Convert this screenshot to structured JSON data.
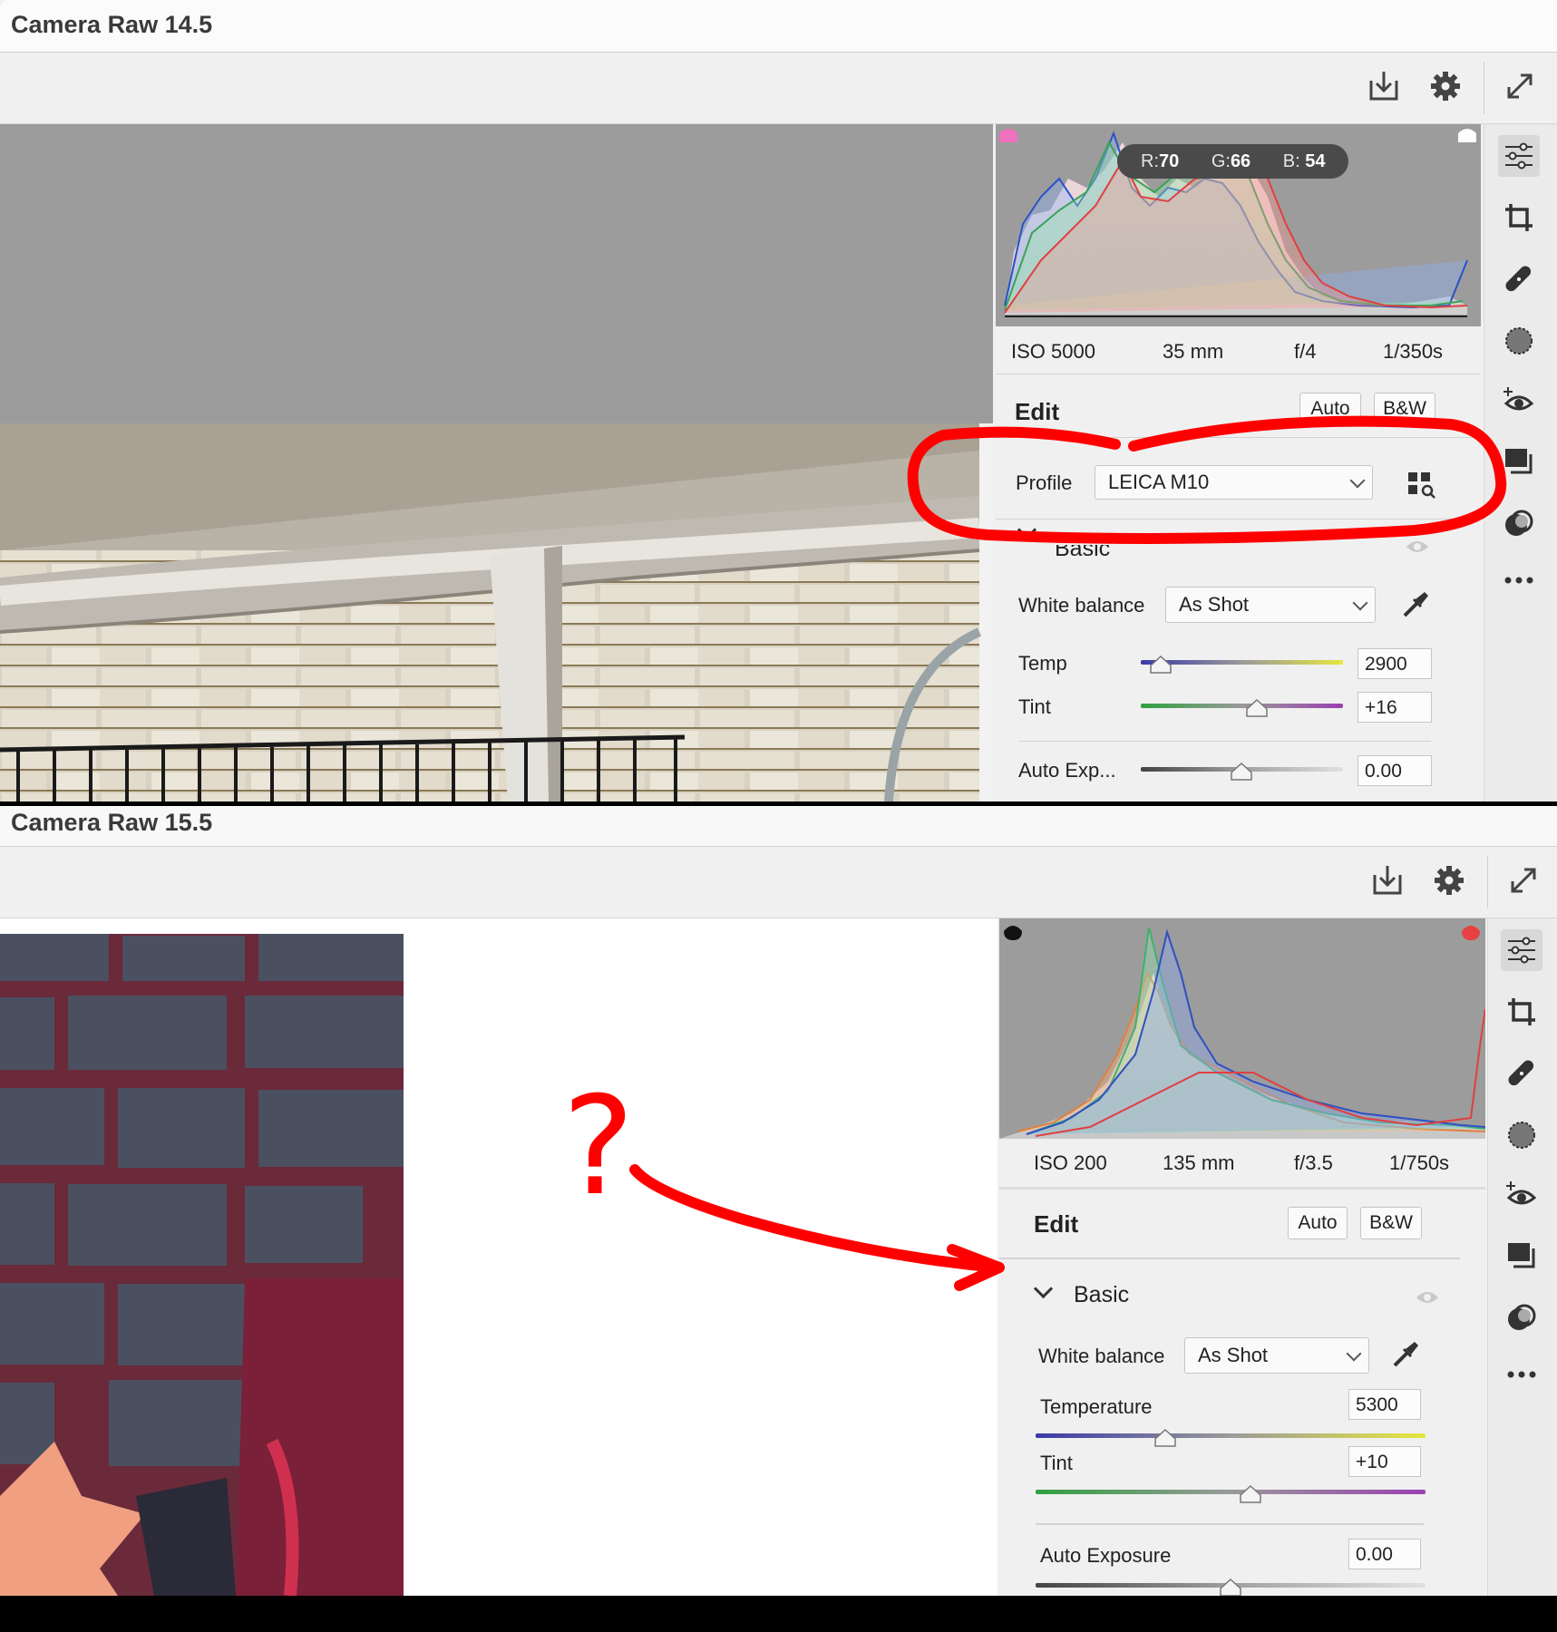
{
  "top": {
    "title": "Camera Raw 14.5",
    "toolbar": {
      "save_icon": "download-icon",
      "settings_icon": "gear-icon",
      "fullscreen_icon": "expand-icon"
    },
    "histogram": {
      "r_label": "R:",
      "r_value": "70",
      "g_label": "G:",
      "g_value": "66",
      "b_label": "B: ",
      "b_value": "54"
    },
    "meta": {
      "iso": "ISO 5000",
      "focal": "35 mm",
      "aperture": "f/4",
      "shutter": "1/350s"
    },
    "edit": {
      "title": "Edit",
      "auto": "Auto",
      "bw": "B&W"
    },
    "profile": {
      "label": "Profile",
      "value": "LEICA M10"
    },
    "basic": {
      "label": "Basic"
    },
    "white_balance": {
      "label": "White balance",
      "value": "As Shot"
    },
    "sliders": [
      {
        "label": "Temp",
        "value": "2900",
        "position": 0.08
      },
      {
        "label": "Tint",
        "value": "+16",
        "position": 0.58
      },
      {
        "label": "Auto Exp...",
        "value": "0.00",
        "position": 0.5
      }
    ]
  },
  "bottom": {
    "title": "Camera Raw 15.5",
    "histogram": {},
    "meta": {
      "iso": "ISO 200",
      "focal": "135 mm",
      "aperture": "f/3.5",
      "shutter": "1/750s"
    },
    "edit": {
      "title": "Edit",
      "auto": "Auto",
      "bw": "B&W"
    },
    "basic": {
      "label": "Basic"
    },
    "white_balance": {
      "label": "White balance",
      "value": "As Shot"
    },
    "sliders": [
      {
        "label": "Temperature",
        "value": "5300",
        "position": 0.33
      },
      {
        "label": "Tint",
        "value": "+10",
        "position": 0.55
      },
      {
        "label": "Auto Exposure",
        "value": "0.00",
        "position": 0.5
      }
    ]
  },
  "annotation": {
    "question_mark": "?"
  },
  "colors": {
    "annotation_red": "#ff0000",
    "panel_bg": "#f0f0f0",
    "histogram_bg": "#9c9c9c"
  },
  "rail_icons": [
    "edit-sliders-icon",
    "crop-icon",
    "healing-icon",
    "masking-icon",
    "red-eye-icon",
    "snapshots-icon",
    "presets-icon",
    "more-icon"
  ]
}
